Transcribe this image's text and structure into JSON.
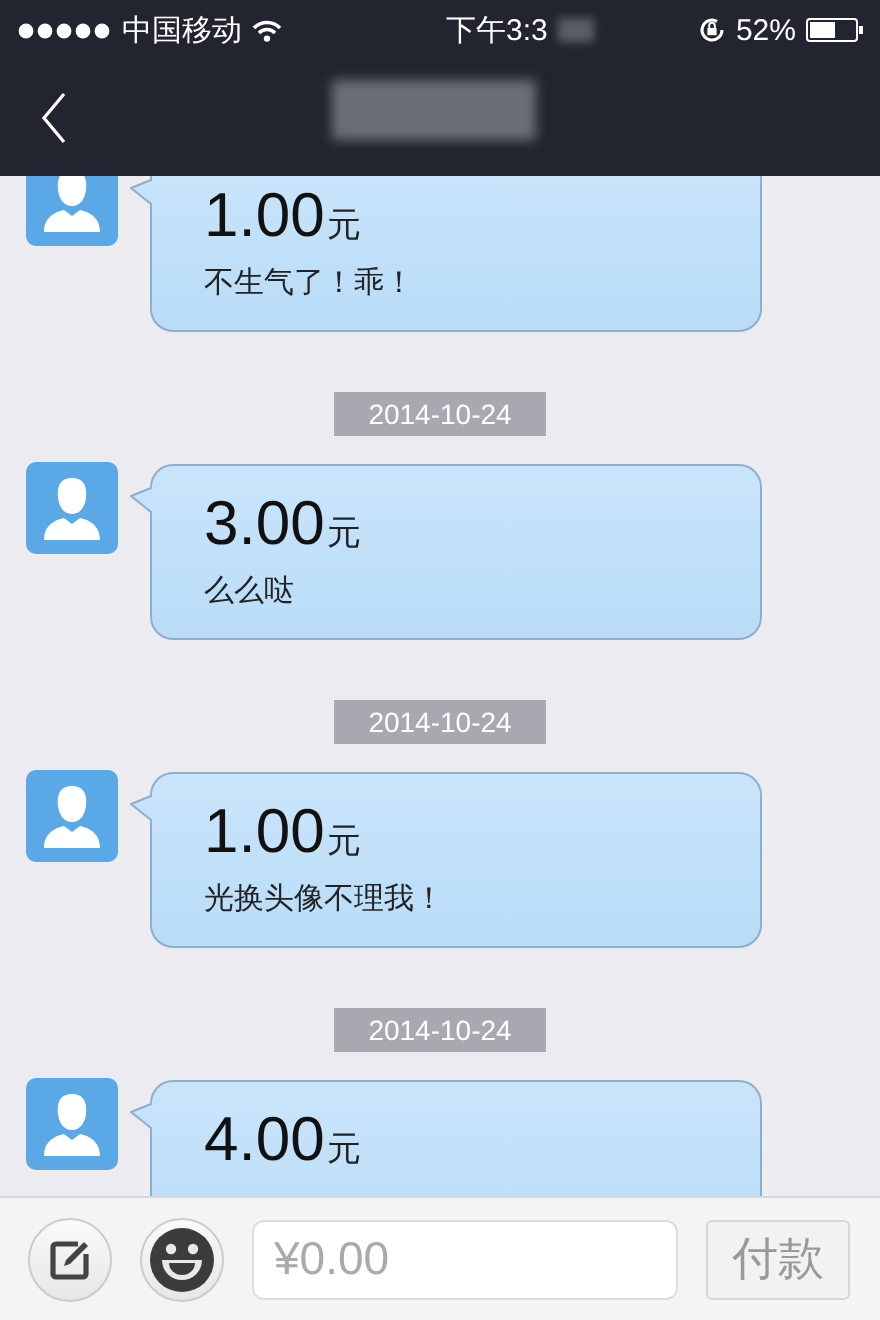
{
  "status_bar": {
    "carrier": "中国移动",
    "time": "下午3:3",
    "battery": "52%"
  },
  "messages": [
    {
      "kind": "transfer",
      "amount": "1.00",
      "unit": "元",
      "note": "不生气了！乖！"
    },
    {
      "kind": "date",
      "text": "2014-10-24"
    },
    {
      "kind": "transfer",
      "amount": "3.00",
      "unit": "元",
      "note": "么么哒"
    },
    {
      "kind": "date",
      "text": "2014-10-24"
    },
    {
      "kind": "transfer",
      "amount": "1.00",
      "unit": "元",
      "note": "光换头像不理我！"
    },
    {
      "kind": "date",
      "text": "2014-10-24"
    },
    {
      "kind": "transfer",
      "amount": "4.00",
      "unit": "元"
    }
  ],
  "input_bar": {
    "placeholder": "¥0.00",
    "pay_button": {
      "label": "付款",
      "disabled": true
    }
  }
}
